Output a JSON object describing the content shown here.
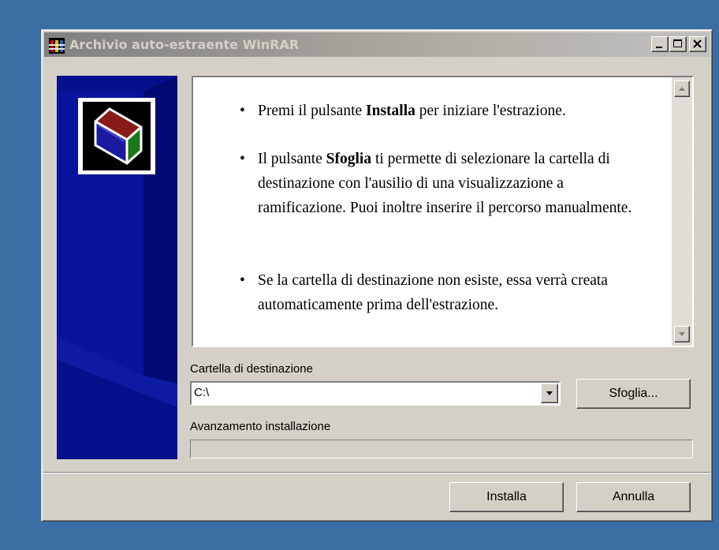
{
  "window": {
    "title": "Archivio auto-estraente WinRAR",
    "title_color": "#d4d0c8",
    "face_color": "#d4d0c8",
    "desktop_color": "#3a6ea5"
  },
  "title_buttons": {
    "minimize": "minimize-icon",
    "maximize": "maximize-icon",
    "close": "close-icon"
  },
  "side_panel": {
    "color": "#060f8c",
    "logo": "winrar-books-logo"
  },
  "info": {
    "items": [
      {
        "pre": "Premi il pulsante ",
        "bold": "Installa",
        "post": " per iniziare l'estrazione."
      },
      {
        "pre": "Il pulsante ",
        "bold": "Sfoglia",
        "post": " ti permette di selezionare la cartella di destinazione con l'ausilio di una visualizzazione a ramificazione. Puoi inoltre inserire il percorso manualmente."
      },
      {
        "pre": "Se la cartella di destinazione non esiste, essa verrà creata automaticamente prima dell'estrazione.",
        "bold": "",
        "post": ""
      }
    ]
  },
  "destination": {
    "label": "Cartella di destinazione",
    "value": "C:\\",
    "browse_label": "Sfoglia..."
  },
  "progress": {
    "label": "Avanzamento installazione",
    "value": 0
  },
  "footer": {
    "install_label": "Installa",
    "cancel_label": "Annulla"
  }
}
